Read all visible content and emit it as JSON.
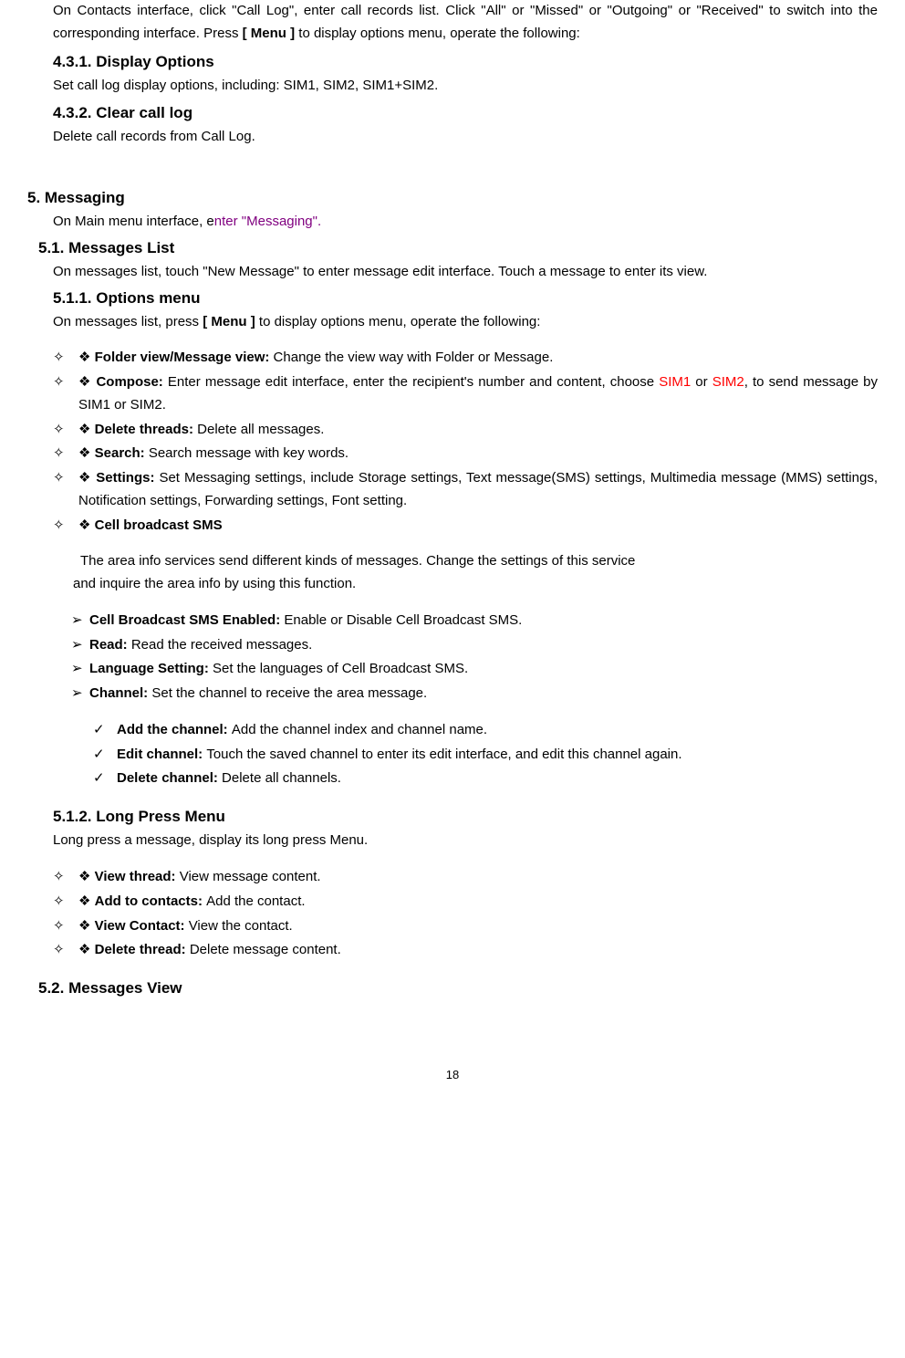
{
  "intro": {
    "p1_pre": "On Contacts interface, click \"Call Log\", enter call records list. Click \"All\" or \"Missed\" or \"Outgoing\" or \"Received\" to switch into the corresponding interface. Press ",
    "p1_bold": "[ Menu ]",
    "p1_post": " to display options menu, operate the following:"
  },
  "s431": {
    "heading": "4.3.1.    Display Options",
    "body": "Set call log display options, including: SIM1, SIM2, SIM1+SIM2."
  },
  "s432": {
    "heading": "4.3.2.    Clear call log",
    "body": "Delete call records from Call Log."
  },
  "s5": {
    "heading": "5.    Messaging",
    "body_pre": "On Main menu interface, e",
    "body_purple": "nter \"Messaging\".",
    "body_post": ""
  },
  "s51": {
    "heading": "5.1.   Messages List",
    "body": "On messages list, touch \"New Message\" to enter message edit interface. Touch a message to enter its view."
  },
  "s511": {
    "heading": "5.1.1.  Options menu",
    "body_pre": "On messages list, press ",
    "body_bold": "[ Menu ]",
    "body_post": " to display options menu, operate the following:"
  },
  "options": {
    "folder": {
      "label": "Folder view/Message view: ",
      "text": "Change the view way with Folder or Message."
    },
    "compose": {
      "label": "Compose: ",
      "pre": "Enter message edit interface, enter the recipient's number and content, choose ",
      "sim1": "SIM1",
      "mid": " or ",
      "sim2": "SIM2",
      "post": ", to send message by SIM1 or SIM2."
    },
    "delete": {
      "label": "Delete threads: ",
      "text": "Delete all messages."
    },
    "search": {
      "label": "Search: ",
      "text": "Search message with key words."
    },
    "settings": {
      "label": "Settings: ",
      "text": "Set Messaging settings, include Storage settings, Text message(SMS) settings, Multimedia message (MMS) settings, Notification settings, Forwarding settings, Font setting."
    },
    "cbs": {
      "label": "Cell broadcast SMS"
    }
  },
  "cbs_desc1": " The area info services send different kinds of messages. Change the settings of this service",
  "cbs_desc2": "and inquire the area info by using this function.",
  "cbs_items": {
    "enabled": {
      "label": "Cell Broadcast SMS Enabled: ",
      "text": "Enable or Disable Cell Broadcast SMS."
    },
    "read": {
      "label": "Read: ",
      "text": "Read the received messages."
    },
    "lang": {
      "label": "Language Setting: ",
      "text": "Set the languages of Cell Broadcast SMS."
    },
    "channel": {
      "label": "Channel: ",
      "text": "Set the channel to receive the area message."
    }
  },
  "channel_items": {
    "add": {
      "label": "Add the channel: ",
      "text": "Add the channel index and channel name."
    },
    "edit": {
      "label": "Edit channel: ",
      "text": "Touch the saved channel to enter its edit interface, and edit this channel again."
    },
    "del": {
      "label": "Delete channel: ",
      "text": "Delete all channels."
    }
  },
  "s512": {
    "heading": "5.1.2.  Long Press Menu",
    "body": "Long press a message, display its long press Menu."
  },
  "lpm": {
    "view_thread": {
      "label": "View thread: ",
      "text": "View message content."
    },
    "add_contacts": {
      "label": "Add to contacts: ",
      "text": "Add the contact."
    },
    "view_contact": {
      "label": "View Contact: ",
      "text": "View the contact."
    },
    "delete_thread": {
      "label": "Delete thread: ",
      "text": "Delete message content."
    }
  },
  "s52": {
    "heading": "5.2.   Messages View"
  },
  "page_num": "18",
  "glyph": {
    "diamond": "✧",
    "arrow": "➢",
    "check": "✓"
  }
}
